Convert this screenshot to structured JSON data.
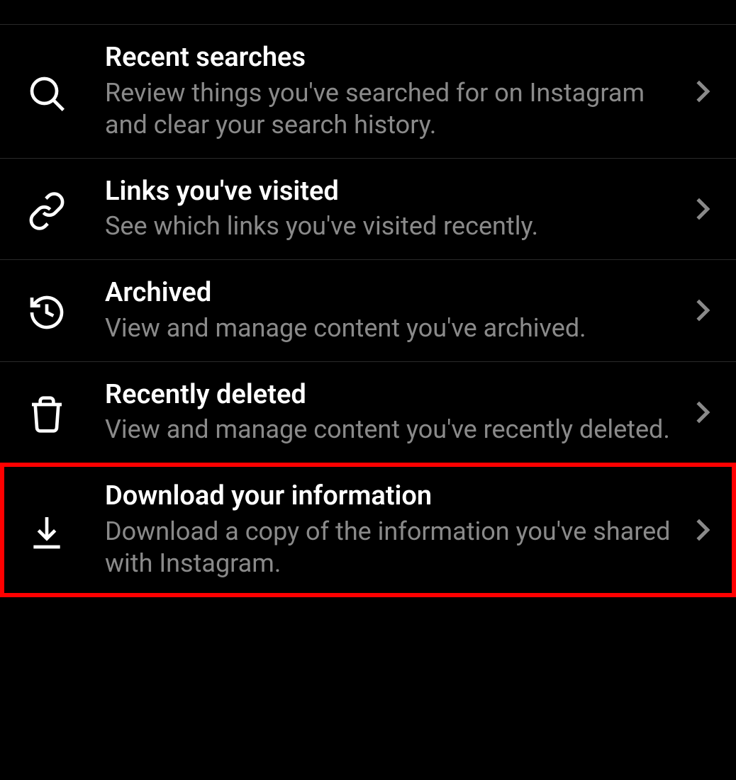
{
  "items": [
    {
      "title": "Recent searches",
      "desc": "Review things you've searched for on Instagram and clear your search history."
    },
    {
      "title": "Links you've visited",
      "desc": "See which links you've visited recently."
    },
    {
      "title": "Archived",
      "desc": "View and manage content you've archived."
    },
    {
      "title": "Recently deleted",
      "desc": "View and manage content you've recently deleted."
    },
    {
      "title": "Download your information",
      "desc": "Download a copy of the information you've shared with Instagram."
    }
  ]
}
